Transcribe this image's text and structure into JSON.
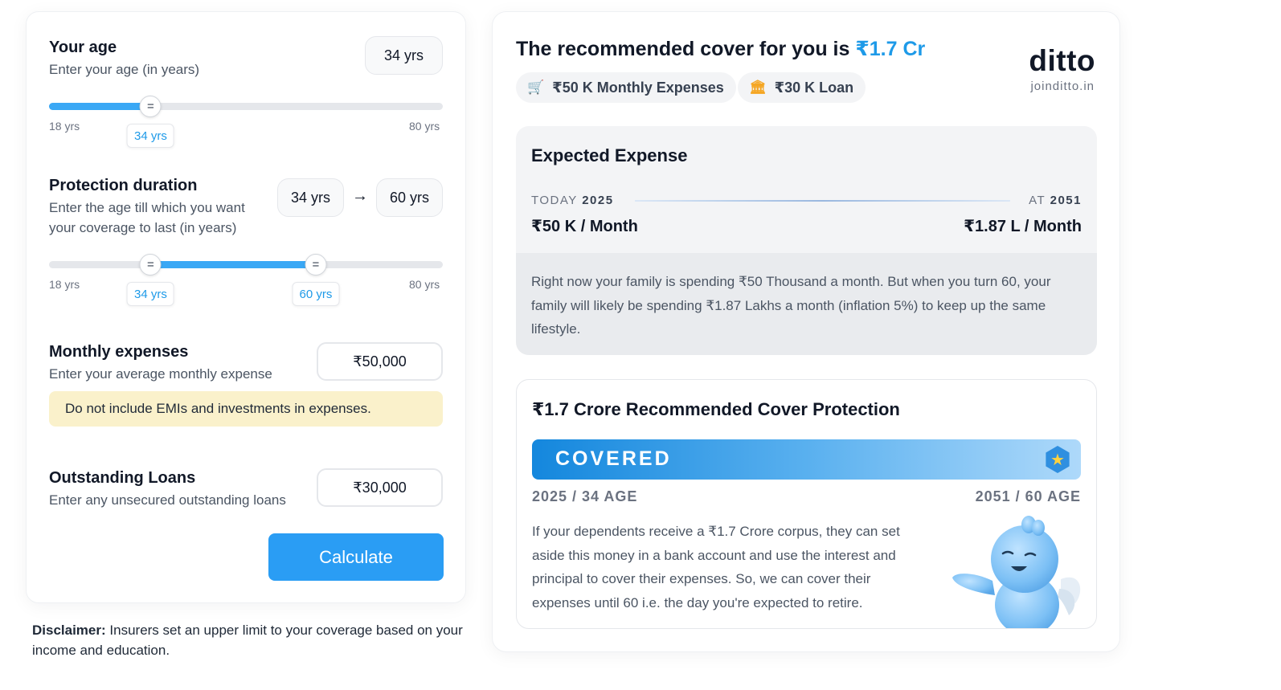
{
  "age": {
    "title": "Your age",
    "subtitle": "Enter your age (in years)",
    "value_box": "34 yrs",
    "slider": {
      "min_label": "18 yrs",
      "max_label": "80 yrs",
      "value_label": "34 yrs",
      "value": 34,
      "min": 18,
      "max": 80
    }
  },
  "duration": {
    "title": "Protection duration",
    "subtitle": "Enter the age till which you want your coverage to last (in years)",
    "from_box": "34 yrs",
    "to_box": "60 yrs",
    "slider": {
      "min_label": "18 yrs",
      "max_label": "80 yrs",
      "from_label": "34 yrs",
      "to_label": "60 yrs",
      "from": 34,
      "to": 60,
      "min": 18,
      "max": 80
    }
  },
  "expenses": {
    "title": "Monthly expenses",
    "subtitle": "Enter your average monthly expense",
    "value": "₹50,000",
    "note": "Do not include EMIs and investments in expenses."
  },
  "loans": {
    "title": "Outstanding Loans",
    "subtitle": "Enter any unsecured outstanding loans",
    "value": "₹30,000"
  },
  "calculate_label": "Calculate",
  "disclaimer": {
    "bold": "Disclaimer:",
    "text": " Insurers set an upper limit to your coverage based on your income and education."
  },
  "recommendation": {
    "title_prefix": "The recommended cover for you is ",
    "amount": "₹1.7 Cr",
    "chips": [
      {
        "icon": "cart-icon",
        "label": "₹50 K Monthly Expenses"
      },
      {
        "icon": "bank-icon",
        "label": "₹30 K Loan"
      }
    ],
    "brand": "ditto",
    "brand_url": "joinditto.in"
  },
  "expected_expense": {
    "title": "Expected Expense",
    "today_label": "TODAY",
    "today_year": "2025",
    "at_label": "AT",
    "at_year": "2051",
    "today_value": "₹50 K / Month",
    "future_value": "₹1.87 L / Month",
    "description": "Right now your family is spending ₹50 Thousand a month. But when you turn 60, your family will likely be spending ₹1.87 Lakhs a month (inflation 5%) to keep up the same lifestyle."
  },
  "cover_protection": {
    "title": "₹1.7 Crore Recommended Cover Protection",
    "status": "COVERED",
    "start_label": "2025 / 34 AGE",
    "end_label": "2051 / 60 AGE",
    "description": "If your dependents receive a ₹1.7 Crore corpus, they can set aside this money in a bank account and use the interest and principal to cover their expenses. So, we can cover their expenses until 60 i.e. the day you're expected to retire."
  },
  "colors": {
    "accent": "#1e9ae8",
    "button": "#2a9df4",
    "slider_fill": "#3aa8f5",
    "note_bg": "#faf1cb",
    "chip_icon": "#f5a623"
  }
}
